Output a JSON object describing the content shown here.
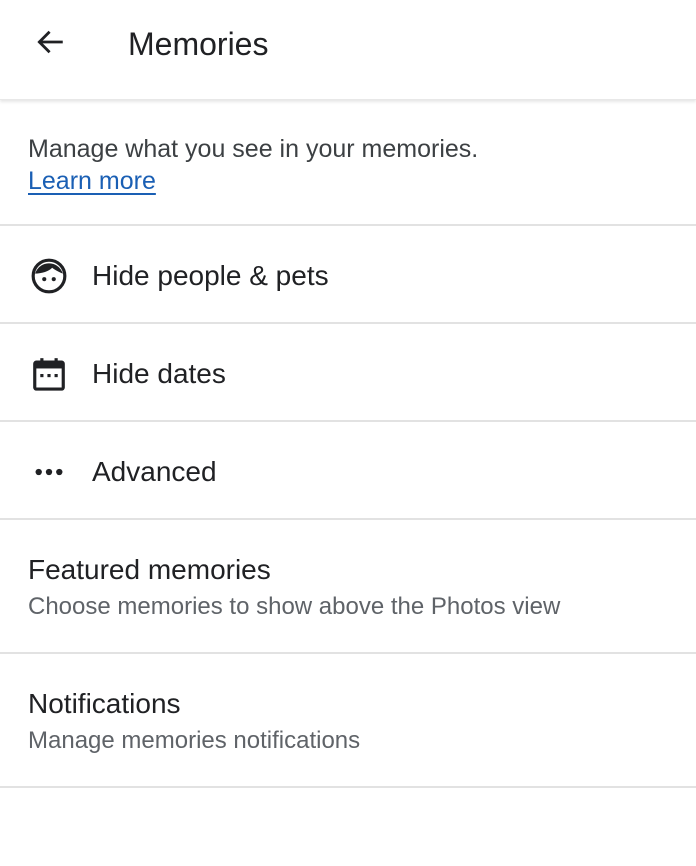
{
  "header": {
    "back_icon": "arrow-back-icon",
    "title": "Memories"
  },
  "intro": {
    "text": "Manage what you see in your memories.",
    "link": "Learn more",
    "link_color": "#1a5fb4"
  },
  "items": [
    {
      "icon": "face-icon",
      "label": "Hide people & pets"
    },
    {
      "icon": "calendar-icon",
      "label": "Hide dates"
    },
    {
      "icon": "more-horiz-icon",
      "label": "Advanced"
    }
  ],
  "settings": [
    {
      "title": "Featured memories",
      "subtitle": "Choose memories to show above the Photos view"
    },
    {
      "title": "Notifications",
      "subtitle": "Manage memories notifications"
    }
  ]
}
